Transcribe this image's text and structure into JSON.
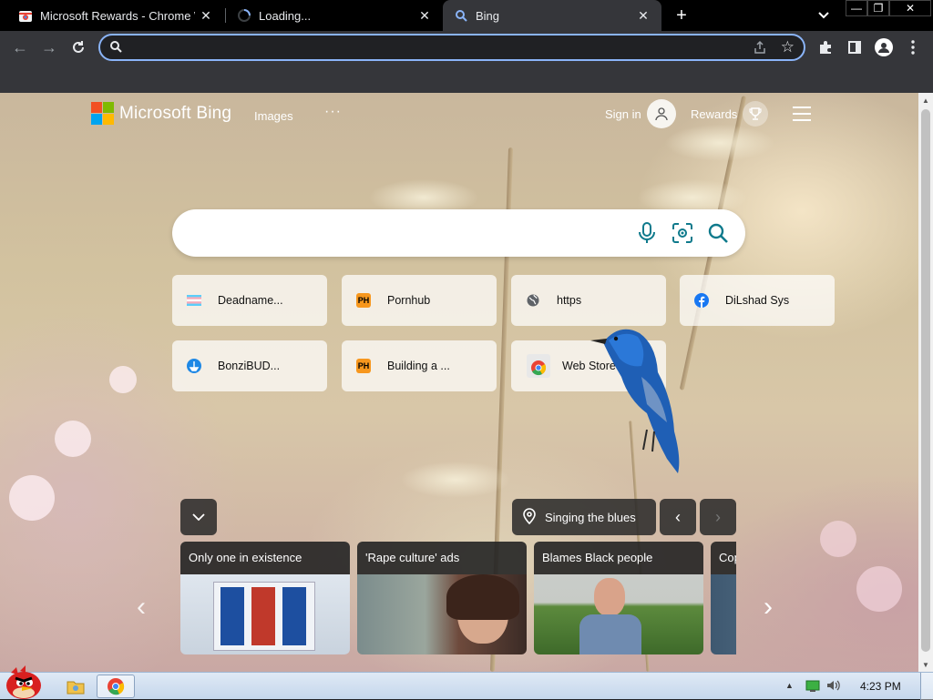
{
  "browser": {
    "tabs": [
      {
        "title": "Microsoft Rewards - Chrome W",
        "favicon": "chrome-web-store-icon"
      },
      {
        "title": "Loading...",
        "favicon": "loading-spinner-icon"
      },
      {
        "title": "Bing",
        "favicon": "search-icon",
        "active": true
      }
    ],
    "address_value": "",
    "window_controls": [
      "minimize",
      "restore",
      "close"
    ]
  },
  "bing": {
    "brand": "Microsoft Bing",
    "nav_images": "Images",
    "nav_more": "···",
    "sign_in": "Sign in",
    "rewards": "Rewards",
    "search_value": ""
  },
  "quick_links": [
    {
      "label": "Deadname...",
      "icon": "trans-flag-icon"
    },
    {
      "label": "Pornhub",
      "icon": "ph-icon"
    },
    {
      "label": "https",
      "icon": "globe-icon"
    },
    {
      "label": "DiLshad Sys",
      "icon": "facebook-icon"
    },
    {
      "label": "BonziBUD...",
      "icon": "bonzi-icon"
    },
    {
      "label": "Building a ...",
      "icon": "ph-icon"
    },
    {
      "label": "Web Store",
      "icon": "chrome-icon"
    }
  ],
  "image_info": {
    "location_label": "Singing the blues"
  },
  "news_cards": [
    {
      "title": "Only one in existence"
    },
    {
      "title": "'Rape culture' ads"
    },
    {
      "title": "Blames Black people"
    },
    {
      "title": "Cop"
    }
  ],
  "taskbar": {
    "clock": "4:23 PM"
  },
  "colors": {
    "ms_red": "#f25022",
    "ms_green": "#7fba00",
    "ms_blue": "#00a4ef",
    "ms_yellow": "#ffb900",
    "bing_teal": "#0e7a8c",
    "omnibox_focus": "#8ab4f8",
    "ph_orange": "#f7971d"
  }
}
